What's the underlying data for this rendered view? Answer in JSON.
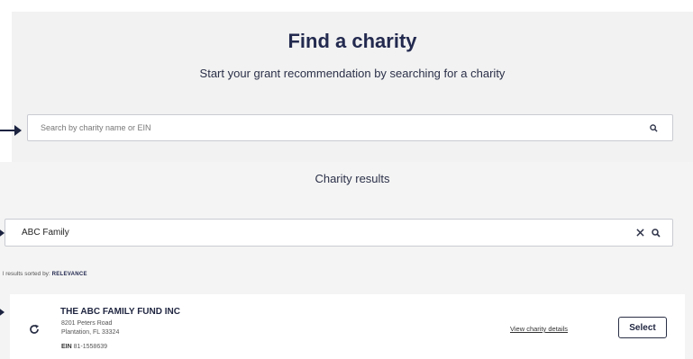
{
  "header": {
    "title": "Find a charity",
    "subtitle": "Start your grant recommendation by searching for a charity"
  },
  "search": {
    "placeholder": "Search by charity name or EIN",
    "icon": "search-icon"
  },
  "results": {
    "heading": "Charity results",
    "query": "ABC Family",
    "clear_icon": "close-icon",
    "sort_prefix": "l results sorted by:",
    "sort_value": "RELEVANCE"
  },
  "charity": {
    "name": "THE ABC FAMILY FUND INC",
    "address_line1": "8201 Peters Road",
    "address_line2": "Plantation, FL 33324",
    "ein_label": "EIN",
    "ein_value": "81-1558639",
    "view_details": "View charity details",
    "select": "Select"
  },
  "colors": {
    "heading": "#232a4f",
    "arrow": "#1b2340",
    "panel": "#f2f2f2"
  }
}
